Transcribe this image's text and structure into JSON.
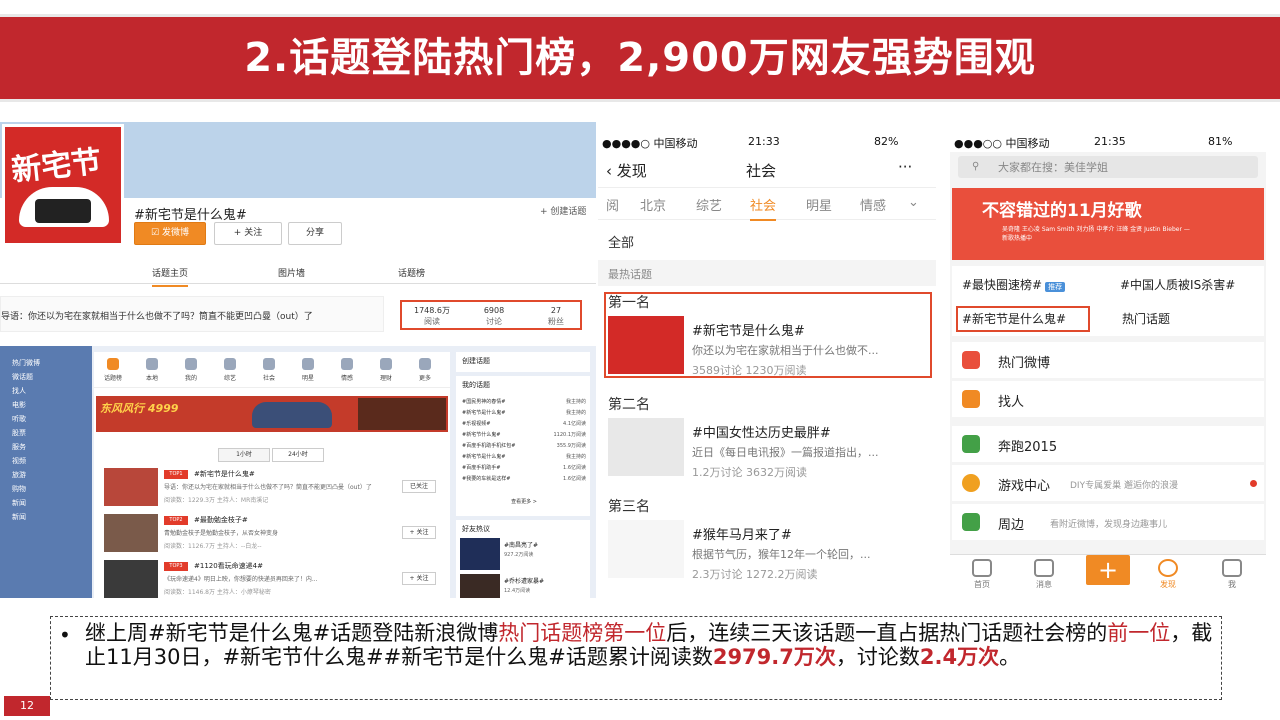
{
  "slide": {
    "title": "2.话题登陆热门榜，2,900万网友强势围观",
    "page_number": "12",
    "colors": {
      "accent": "#c1272d",
      "highlight": "#e04a2c",
      "orange": "#f08a24"
    }
  },
  "weibo_topic_page": {
    "logo_text": "新宅节",
    "topic_name": "#新宅节是什么鬼#",
    "create_topic": "+ 创建话题",
    "buttons": {
      "post": "发微博",
      "follow": "+ 关注",
      "share": "分享"
    },
    "tabs": [
      "话题主页",
      "图片墙",
      "话题榜"
    ],
    "guide": "导语：你还以为宅在家就相当于什么也做不了吗？筒直不能更凹凸曼（out）了",
    "stats": [
      {
        "value": "1748.6万",
        "label": "阅读"
      },
      {
        "value": "6908",
        "label": "讨论"
      },
      {
        "value": "27",
        "label": "粉丝"
      }
    ]
  },
  "weibo_hot_list": {
    "left_nav": [
      "热门微博",
      "微话题",
      "找人",
      "电影",
      "听歌",
      "股票",
      "服务",
      "视频",
      "旅游",
      "购物",
      "新闻",
      "新闻"
    ],
    "icons": [
      {
        "label": "话题榜",
        "icon": "topic-icon"
      },
      {
        "label": "本地",
        "icon": "location-icon"
      },
      {
        "label": "我的",
        "icon": "user-icon"
      },
      {
        "label": "综艺",
        "icon": "tv-icon"
      },
      {
        "label": "社会",
        "icon": "globe-icon"
      },
      {
        "label": "明星",
        "icon": "star-icon"
      },
      {
        "label": "情感",
        "icon": "heart-icon"
      },
      {
        "label": "理财",
        "icon": "chart-icon"
      },
      {
        "label": "更多",
        "icon": "more-icon"
      }
    ],
    "ad_text": "东风风行 4999",
    "toggle": [
      "1小时",
      "24小时"
    ],
    "items": [
      {
        "badge": "TOP1",
        "title": "#新宅节是什么鬼#",
        "desc": "导语：你还以为宅在家就相当于什么也做不了吗？筒直不能更凹凸曼（out）了",
        "meta": "阅读数：1229.3万   主持人：MR南溪记",
        "button": "已关注"
      },
      {
        "badge": "TOP2",
        "title": "#最勤勉金枝子#",
        "desc": "青勉勤金枝子是勉勤金枝子，从否女神变身",
        "meta": "阅读数：1126.7万   主持人：--白龙--",
        "button": "+ 关注"
      },
      {
        "badge": "TOP3",
        "title": "#1120看玩命速递4#",
        "desc": "《玩命速递4》明日上映，你想要的快递员再回来了！内...",
        "meta": "阅读数：1146.8万   主持人：小燎琴秘密",
        "button": "+ 关注"
      }
    ],
    "create_topic": "创建话题",
    "my_topics_title": "我的话题",
    "my_topics": [
      {
        "name": "#国民男神的春情#",
        "role": "我主持的"
      },
      {
        "name": "#新宅节是什么鬼#",
        "role": "我主持的"
      },
      {
        "name": "#乐视视频#",
        "role": "4.1亿阅读"
      },
      {
        "name": "#新宅节什么鬼#",
        "role": "1120.1万阅读"
      },
      {
        "name": "#百度手机助手机红包#",
        "role": "355.9万阅读"
      },
      {
        "name": "#新宅节是什么鬼#",
        "role": "我主持的"
      },
      {
        "name": "#百度手机助手#",
        "role": "1.6亿阅读"
      },
      {
        "name": "#我要的车就是这样#",
        "role": "1.6亿阅读"
      }
    ],
    "view_more": "查看更多 >",
    "friends_title": "好友热议",
    "friends": [
      {
        "title": "#南昌亮了#",
        "sub": "927.2万阅读"
      },
      {
        "title": "#乔杉遭家暴#",
        "sub": "12.4万阅读"
      }
    ]
  },
  "mobile_society": {
    "status": {
      "carrier": "●●●●○ 中国移动",
      "time": "21:33",
      "battery": "82%"
    },
    "back": "发现",
    "nav_title": "社会",
    "more": "···",
    "categories": [
      "阅",
      "北京",
      "综艺",
      "社会",
      "明星",
      "情感"
    ],
    "all_label": "全部",
    "section": "最热话题",
    "ranks": [
      {
        "rank": "第一名",
        "title": "#新宅节是什么鬼#",
        "desc": "你还以为宅在家就相当于什么也做不...",
        "meta": "3589讨论   1230万阅读"
      },
      {
        "rank": "第二名",
        "title": "#中国女性达历史最胖#",
        "desc": "近日《每日电讯报》一篇报道指出，...",
        "meta": "1.2万讨论   3632万阅读"
      },
      {
        "rank": "第三名",
        "title": "#猴年马月来了#",
        "desc": "根据节气历，猴年12年一个轮回，...",
        "meta": "2.3万讨论   1272.2万阅读"
      }
    ]
  },
  "mobile_discover": {
    "status": {
      "carrier": "●●●○○ 中国移动",
      "time": "21:35",
      "battery": "81%"
    },
    "search_placeholder": "大家都在搜：美佳学姐",
    "banner_title": "不容错过的11月好歌",
    "banner_sub": "吴奇隆 王心凌 Sam Smith 刘力扬 中孝介 汪峰 金贤 Justin Bieber — 新歌热播中",
    "grid": [
      {
        "label": "#最快圈速榜#",
        "tag": "推荐"
      },
      {
        "label": "#中国人质被IS杀害#",
        "tag": ""
      },
      {
        "label": "#新宅节是什么鬼#",
        "tag": ""
      },
      {
        "label": "热门话题",
        "tag": ""
      }
    ],
    "list": [
      {
        "label": "热门微博",
        "sub": "",
        "color": "#e94f3c"
      },
      {
        "label": "找人",
        "sub": "",
        "color": "#f08a24"
      },
      {
        "label": "奔跑2015",
        "sub": "",
        "color": "#43a047"
      },
      {
        "label": "游戏中心",
        "sub": "DIY专属爱巢 邂逅你的浪漫",
        "color": "#f0a020"
      },
      {
        "label": "周边",
        "sub": "看附近微博，发现身边趣事儿",
        "color": "#43a047"
      }
    ],
    "tabbar": [
      "首页",
      "消息",
      "+",
      "发现",
      "我"
    ]
  },
  "note": {
    "part1": "继上周#新宅节是什么鬼#话题登陆新浪微博",
    "part2": "热门话题榜第一位",
    "part3": "后，连续三天该话题一直占据热门话题社会榜的",
    "part4": "前一位",
    "part5": "，截止11月30日，#新宅节什么鬼##新宅节是什么鬼#话题累计阅读数",
    "part6": "2979.7万次",
    "part7": "，讨论数",
    "part8": "2.4万次",
    "part9": "。"
  }
}
